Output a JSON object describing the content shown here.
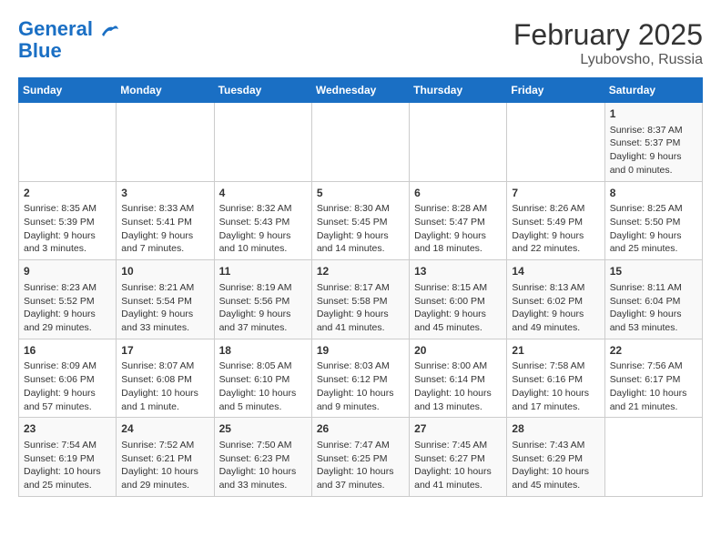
{
  "header": {
    "logo_line1": "General",
    "logo_line2": "Blue",
    "title": "February 2025",
    "subtitle": "Lyubovsho, Russia"
  },
  "days_of_week": [
    "Sunday",
    "Monday",
    "Tuesday",
    "Wednesday",
    "Thursday",
    "Friday",
    "Saturday"
  ],
  "weeks": [
    {
      "days": [
        {
          "num": "",
          "info": ""
        },
        {
          "num": "",
          "info": ""
        },
        {
          "num": "",
          "info": ""
        },
        {
          "num": "",
          "info": ""
        },
        {
          "num": "",
          "info": ""
        },
        {
          "num": "",
          "info": ""
        },
        {
          "num": "1",
          "info": "Sunrise: 8:37 AM\nSunset: 5:37 PM\nDaylight: 9 hours and 0 minutes."
        }
      ]
    },
    {
      "days": [
        {
          "num": "2",
          "info": "Sunrise: 8:35 AM\nSunset: 5:39 PM\nDaylight: 9 hours and 3 minutes."
        },
        {
          "num": "3",
          "info": "Sunrise: 8:33 AM\nSunset: 5:41 PM\nDaylight: 9 hours and 7 minutes."
        },
        {
          "num": "4",
          "info": "Sunrise: 8:32 AM\nSunset: 5:43 PM\nDaylight: 9 hours and 10 minutes."
        },
        {
          "num": "5",
          "info": "Sunrise: 8:30 AM\nSunset: 5:45 PM\nDaylight: 9 hours and 14 minutes."
        },
        {
          "num": "6",
          "info": "Sunrise: 8:28 AM\nSunset: 5:47 PM\nDaylight: 9 hours and 18 minutes."
        },
        {
          "num": "7",
          "info": "Sunrise: 8:26 AM\nSunset: 5:49 PM\nDaylight: 9 hours and 22 minutes."
        },
        {
          "num": "8",
          "info": "Sunrise: 8:25 AM\nSunset: 5:50 PM\nDaylight: 9 hours and 25 minutes."
        }
      ]
    },
    {
      "days": [
        {
          "num": "9",
          "info": "Sunrise: 8:23 AM\nSunset: 5:52 PM\nDaylight: 9 hours and 29 minutes."
        },
        {
          "num": "10",
          "info": "Sunrise: 8:21 AM\nSunset: 5:54 PM\nDaylight: 9 hours and 33 minutes."
        },
        {
          "num": "11",
          "info": "Sunrise: 8:19 AM\nSunset: 5:56 PM\nDaylight: 9 hours and 37 minutes."
        },
        {
          "num": "12",
          "info": "Sunrise: 8:17 AM\nSunset: 5:58 PM\nDaylight: 9 hours and 41 minutes."
        },
        {
          "num": "13",
          "info": "Sunrise: 8:15 AM\nSunset: 6:00 PM\nDaylight: 9 hours and 45 minutes."
        },
        {
          "num": "14",
          "info": "Sunrise: 8:13 AM\nSunset: 6:02 PM\nDaylight: 9 hours and 49 minutes."
        },
        {
          "num": "15",
          "info": "Sunrise: 8:11 AM\nSunset: 6:04 PM\nDaylight: 9 hours and 53 minutes."
        }
      ]
    },
    {
      "days": [
        {
          "num": "16",
          "info": "Sunrise: 8:09 AM\nSunset: 6:06 PM\nDaylight: 9 hours and 57 minutes."
        },
        {
          "num": "17",
          "info": "Sunrise: 8:07 AM\nSunset: 6:08 PM\nDaylight: 10 hours and 1 minute."
        },
        {
          "num": "18",
          "info": "Sunrise: 8:05 AM\nSunset: 6:10 PM\nDaylight: 10 hours and 5 minutes."
        },
        {
          "num": "19",
          "info": "Sunrise: 8:03 AM\nSunset: 6:12 PM\nDaylight: 10 hours and 9 minutes."
        },
        {
          "num": "20",
          "info": "Sunrise: 8:00 AM\nSunset: 6:14 PM\nDaylight: 10 hours and 13 minutes."
        },
        {
          "num": "21",
          "info": "Sunrise: 7:58 AM\nSunset: 6:16 PM\nDaylight: 10 hours and 17 minutes."
        },
        {
          "num": "22",
          "info": "Sunrise: 7:56 AM\nSunset: 6:17 PM\nDaylight: 10 hours and 21 minutes."
        }
      ]
    },
    {
      "days": [
        {
          "num": "23",
          "info": "Sunrise: 7:54 AM\nSunset: 6:19 PM\nDaylight: 10 hours and 25 minutes."
        },
        {
          "num": "24",
          "info": "Sunrise: 7:52 AM\nSunset: 6:21 PM\nDaylight: 10 hours and 29 minutes."
        },
        {
          "num": "25",
          "info": "Sunrise: 7:50 AM\nSunset: 6:23 PM\nDaylight: 10 hours and 33 minutes."
        },
        {
          "num": "26",
          "info": "Sunrise: 7:47 AM\nSunset: 6:25 PM\nDaylight: 10 hours and 37 minutes."
        },
        {
          "num": "27",
          "info": "Sunrise: 7:45 AM\nSunset: 6:27 PM\nDaylight: 10 hours and 41 minutes."
        },
        {
          "num": "28",
          "info": "Sunrise: 7:43 AM\nSunset: 6:29 PM\nDaylight: 10 hours and 45 minutes."
        },
        {
          "num": "",
          "info": ""
        }
      ]
    }
  ]
}
